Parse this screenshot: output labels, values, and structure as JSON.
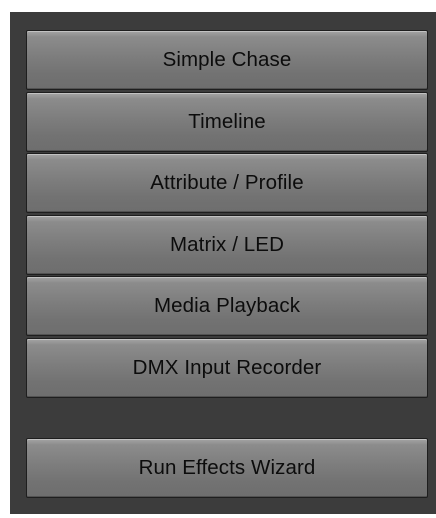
{
  "effects_menu": {
    "items": [
      {
        "label": "Simple Chase"
      },
      {
        "label": "Timeline"
      },
      {
        "label": "Attribute / Profile"
      },
      {
        "label": "Matrix / LED"
      },
      {
        "label": "Media Playback"
      },
      {
        "label": "DMX Input Recorder"
      }
    ],
    "wizard_label": "Run Effects Wizard"
  },
  "colors": {
    "panel_background": "#3c3c3c",
    "button_face": "#7d7d7d",
    "button_text": "#0c0c0c"
  }
}
